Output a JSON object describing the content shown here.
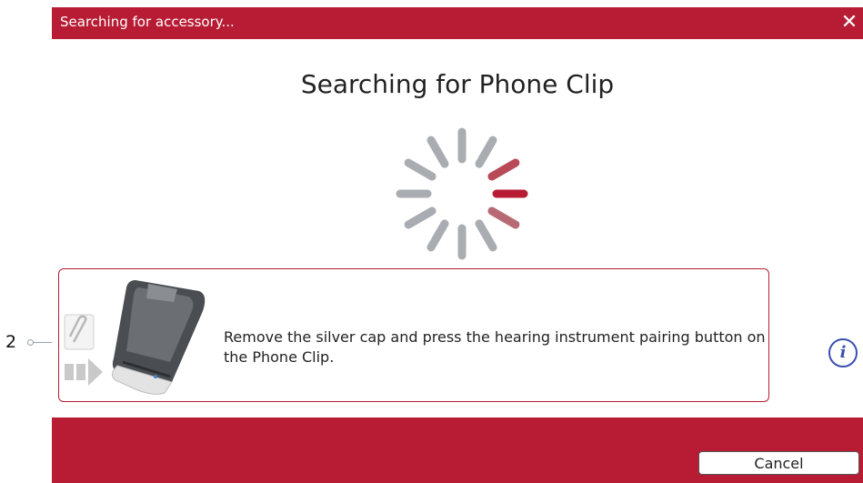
{
  "callout": {
    "number": "2"
  },
  "dialog": {
    "title": "Searching for accessory...",
    "close_glyph": "✕",
    "heading": "Searching for Phone Clip",
    "instruction": "Remove the silver cap and press the hearing instrument pairing button on the Phone Clip.",
    "info_glyph": "i",
    "cancel_label": "Cancel"
  },
  "colors": {
    "brand": "#b71c34",
    "spinner_active": "#b84a58",
    "spinner_inactive": "#a9adb2",
    "info": "#3a4fb0"
  },
  "icons": {
    "spinner": "loading-spinner-icon",
    "info": "info-icon",
    "close": "close-icon",
    "paperclip": "paperclip-icon",
    "arrow": "arrow-right-icon"
  }
}
